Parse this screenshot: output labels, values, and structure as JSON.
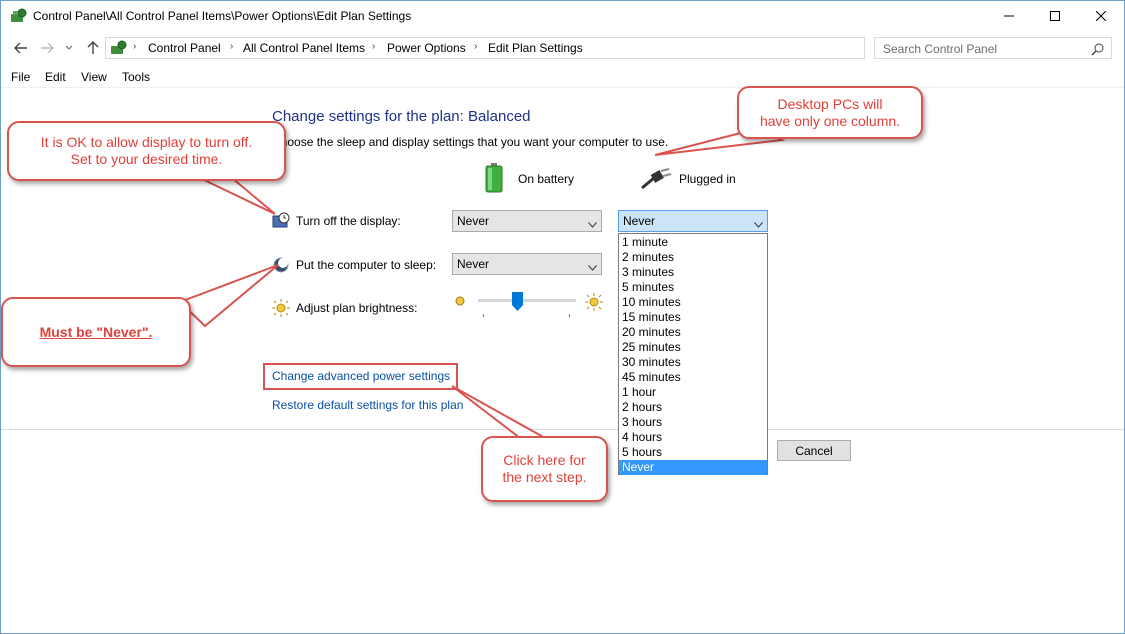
{
  "window": {
    "title": "Control Panel\\All Control Panel Items\\Power Options\\Edit Plan Settings"
  },
  "address": {
    "crumbs": [
      "Control Panel",
      "All Control Panel Items",
      "Power Options",
      "Edit Plan Settings"
    ],
    "search_placeholder": "Search Control Panel"
  },
  "menu": [
    "File",
    "Edit",
    "View",
    "Tools"
  ],
  "content": {
    "heading": "Change settings for the plan: Balanced",
    "subtext": "Choose the sleep and display settings that you want your computer to use.",
    "columns": {
      "battery": "On battery",
      "plugged": "Plugged in"
    },
    "rows": {
      "display_label": "Turn off the display:",
      "display_battery": "Never",
      "display_plugged": "Never",
      "sleep_label": "Put the computer to sleep:",
      "sleep_battery": "Never",
      "brightness_label": "Adjust plan brightness:",
      "brightness_level": 0.4
    },
    "links": {
      "advanced": "Change advanced power settings",
      "restore": "Restore default settings for this plan"
    },
    "buttons": {
      "cancel": "Cancel"
    }
  },
  "dropdown": {
    "options": [
      "1 minute",
      "2 minutes",
      "3 minutes",
      "5 minutes",
      "10 minutes",
      "15 minutes",
      "20 minutes",
      "25 minutes",
      "30 minutes",
      "45 minutes",
      "1 hour",
      "2 hours",
      "3 hours",
      "4 hours",
      "5 hours",
      "Never"
    ],
    "selected": "Never"
  },
  "callouts": {
    "display_note": [
      "It is OK to allow display to turn off.",
      "Set to your desired time."
    ],
    "desktop_note": [
      "Desktop PCs will",
      "have only one column."
    ],
    "sleep_note": "Must be \"Never\".",
    "click_note": [
      "Click here for",
      "the next step."
    ]
  },
  "colors": {
    "accent": "#1e3287",
    "link": "#0a50a5",
    "callout": "#d9534f",
    "selection": "#3399ff"
  }
}
